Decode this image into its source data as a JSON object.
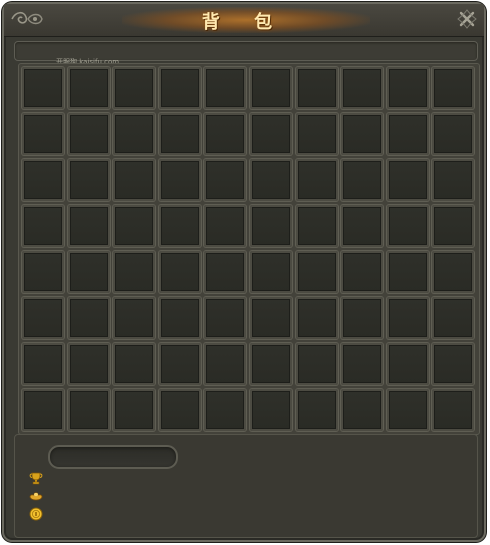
{
  "window": {
    "title": "背 包",
    "watermark": "开服狗  kaisifu.com"
  },
  "inventory": {
    "rows": 8,
    "columns": 10,
    "slots_filled": 0
  },
  "currencies": [
    {
      "name": "trophy-icon",
      "color": "#d9a21b"
    },
    {
      "name": "ingot-icon",
      "color": "#e0a62a"
    },
    {
      "name": "coin-icon",
      "color": "#f2c12e"
    }
  ],
  "colors": {
    "title_glow": "#b8782a",
    "title_text": "#ffe9b0",
    "panel_bg": "#3a3a33",
    "slot_bg": "#2f302a"
  }
}
